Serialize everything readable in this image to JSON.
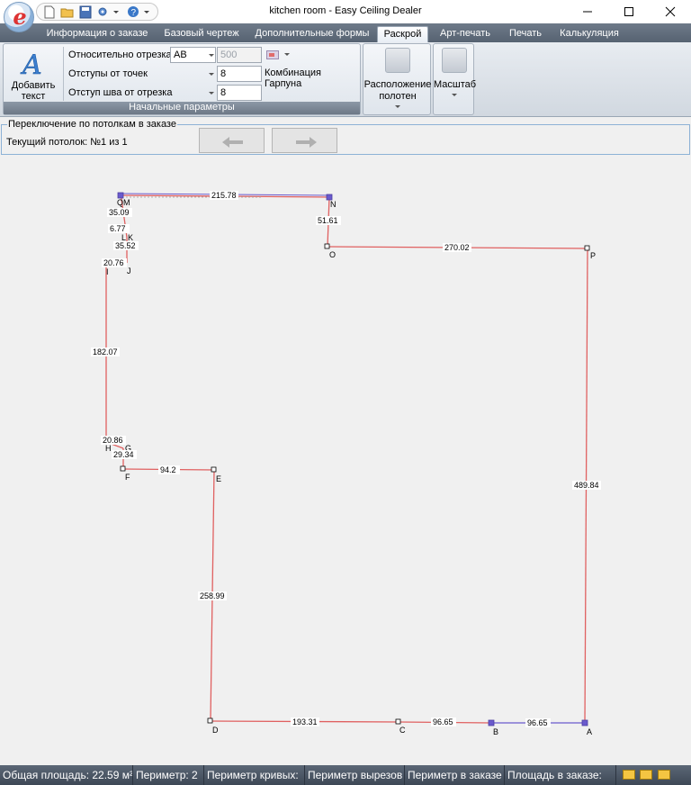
{
  "window": {
    "title": "kitchen room - Easy Ceiling Dealer",
    "logo_letter": "e"
  },
  "quick_access": [
    "new-file-icon",
    "open-folder-icon",
    "save-icon",
    "settings-icon",
    "help-icon"
  ],
  "tabs": [
    {
      "label": "Информация о заказе",
      "active": false
    },
    {
      "label": "Базовый чертеж",
      "active": false
    },
    {
      "label": "Дополнительные формы",
      "active": false
    },
    {
      "label": "Раскрой",
      "active": true
    },
    {
      "label": "Арт-печать",
      "active": false
    },
    {
      "label": "Печать",
      "active": false
    },
    {
      "label": "Калькуляция",
      "active": false
    }
  ],
  "ribbon": {
    "add_text": {
      "icon_letter": "A",
      "label_line1": "Добавить",
      "label_line2": "текст"
    },
    "params": {
      "relative_segment_label": "Относительно отрезка",
      "relative_segment_value": "AB",
      "relative_width_value": "500",
      "point_offsets_label": "Отступы от точек",
      "point_offsets_value": "8",
      "seam_offset_label": "Отступ шва от отрезка",
      "seam_offset_value": "8",
      "harpoon_label": "Комбинация Гарпуна",
      "group_label": "Начальные параметры"
    },
    "layout_button": {
      "line1": "Расположение",
      "line2": "полотен"
    },
    "scale_button": {
      "label": "Масштаб"
    }
  },
  "ceiling_switch": {
    "legend": "Переключение по потолкам в заказе",
    "current": "Текущий потолок: №1 из 1"
  },
  "colors": {
    "edge": "#e06060",
    "seam": "#6a5acd",
    "accent_tab": "#ffffff"
  },
  "drawing": {
    "point_labels": [
      "A",
      "B",
      "C",
      "D",
      "E",
      "F",
      "G",
      "H",
      "I",
      "J",
      "K",
      "L",
      "M",
      "N",
      "O",
      "P",
      "Q"
    ],
    "dimensions": [
      "215.78",
      "51.61",
      "270.02",
      "489.84",
      "96.65",
      "96.65",
      "193.31",
      "258.99",
      "94.2",
      "29.34",
      "20.86",
      "182.07",
      "20.76",
      "35.52",
      "6.77",
      "35.09"
    ]
  },
  "statusbar": {
    "total_area": "Общая площадь: 22.59 м²",
    "perimeter": "Периметр: 2",
    "perimeter_curves": "Периметр кривых:",
    "perimeter_cutouts": "Периметр вырезов",
    "perimeter_order": "Периметр в заказе",
    "area_order": "Площадь в заказе:",
    "icons": [
      "ruler-icon",
      "measure-icon",
      "export-icon"
    ]
  }
}
